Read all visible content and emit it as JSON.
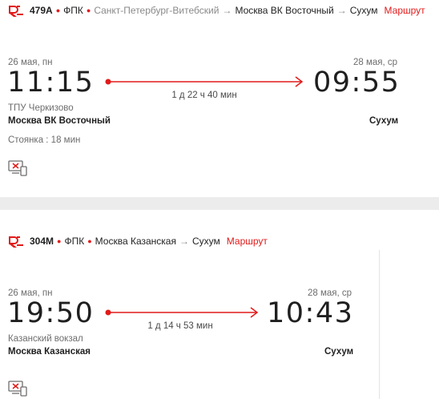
{
  "trains": [
    {
      "number": "479А",
      "carrier": "ФПК",
      "origin": "Санкт-Петербург-Витебский",
      "route_stops": [
        "Москва ВК Восточный",
        "Сухум"
      ],
      "route_link": "Маршрут",
      "departure": {
        "date": "26 мая, пн",
        "time": "11:15",
        "place": "ТПУ Черкизово",
        "station": "Москва ВК Восточный",
        "stop": "Стоянка : 18 мин"
      },
      "arrival": {
        "date": "28 мая, ср",
        "time": "09:55",
        "station": "Сухум"
      },
      "duration": "1 д 22 ч 40 мин"
    },
    {
      "number": "304М",
      "carrier": "ФПК",
      "route_stops": [
        "Москва Казанская",
        "Сухум"
      ],
      "route_link": "Маршрут",
      "departure": {
        "date": "26 мая, пн",
        "time": "19:50",
        "place": "Казанский вокзал",
        "station": "Москва Казанская"
      },
      "arrival": {
        "date": "28 мая, ср",
        "time": "10:43",
        "station": "Сухум"
      },
      "duration": "1 д 14 ч 53 мин"
    }
  ],
  "icons": {
    "logo": "rzd-train-logo-icon",
    "arrow": "arrow-right-icon",
    "eregistration": "no-electronic-registration-icon"
  },
  "colors": {
    "accent": "#e21a1a",
    "text": "#1f1f1f",
    "muted": "#8a8a8a",
    "separator": "#ececec"
  }
}
